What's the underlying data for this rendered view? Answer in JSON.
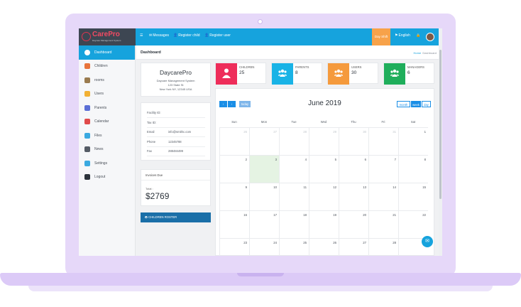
{
  "brand": {
    "name": "CarePro",
    "tagline": "Daycare Management System"
  },
  "topbar": {
    "menu_icon": "hamburger-icon",
    "items": [
      {
        "icon": "envelope-icon",
        "label": "Messages"
      },
      {
        "icon": "user-plus-icon",
        "label": "Register child"
      },
      {
        "icon": "user-plus-icon",
        "label": "Register user"
      }
    ],
    "shift_label": "Day Shift",
    "language": "English",
    "lock_icon": "lock-icon",
    "avatar": "user-avatar"
  },
  "sidebar": {
    "items": [
      {
        "label": "Dashboard",
        "icon": "dashboard-icon",
        "active": true,
        "color": "#2b3540"
      },
      {
        "label": "Children",
        "icon": "children-icon",
        "active": false,
        "color": "#e8743b"
      },
      {
        "label": "rooms",
        "icon": "rooms-icon",
        "active": false,
        "color": "#9a7b4f"
      },
      {
        "label": "Users",
        "icon": "users-icon",
        "active": false,
        "color": "#f2b134"
      },
      {
        "label": "Parents",
        "icon": "parents-icon",
        "active": false,
        "color": "#5b6fd6"
      },
      {
        "label": "Calendar",
        "icon": "calendar-icon",
        "active": false,
        "color": "#e04a4a"
      },
      {
        "label": "Files",
        "icon": "files-icon",
        "active": false,
        "color": "#3aa9e0"
      },
      {
        "label": "News",
        "icon": "news-icon",
        "active": false,
        "color": "#555c66"
      },
      {
        "label": "Settings",
        "icon": "settings-icon",
        "active": false,
        "color": "#3aa9e0"
      },
      {
        "label": "Logout",
        "icon": "power-icon",
        "active": false,
        "color": "#2c333b"
      }
    ]
  },
  "page": {
    "title": "Dashboard",
    "breadcrumb": {
      "home": "Home",
      "current": "Dashboard"
    }
  },
  "facility": {
    "name": "DaycarePro",
    "subtitle": "Daycare Management System",
    "address1": "123 State St",
    "address2": "New York NY, 12345 USA"
  },
  "facility_info": [
    {
      "label": "Facility ID:",
      "value": ""
    },
    {
      "label": "Tax ID:",
      "value": ""
    },
    {
      "label": "Email",
      "value": "info@smithc.com"
    },
    {
      "label": "Phone",
      "value": "12345788"
    },
    {
      "label": "Fax",
      "value": "288484499"
    }
  ],
  "invoices": {
    "title": "Invoices Due",
    "total_label": "Total :",
    "total": "$2769"
  },
  "roster_button": {
    "icon": "print-icon",
    "label": "CHILDREN ROSTER"
  },
  "stats": [
    {
      "label": "CHILDREN",
      "value": "25",
      "color": "#ee2d5a",
      "icon": "child-icon"
    },
    {
      "label": "PARENTS",
      "value": "8",
      "color": "#19b3e6",
      "icon": "group-icon"
    },
    {
      "label": "USERS",
      "value": "30",
      "color": "#f59a3c",
      "icon": "group-icon"
    },
    {
      "label": "MANAGERS",
      "value": "6",
      "color": "#1fae5b",
      "icon": "group-icon"
    }
  ],
  "calendar": {
    "title": "June 2019",
    "prev_icon": "chevron-left-icon",
    "next_icon": "chevron-right-icon",
    "today_label": "today",
    "views": [
      "month",
      "week",
      "day"
    ],
    "active_view": "week",
    "weekdays": [
      "Sun",
      "Mon",
      "Tue",
      "Wed",
      "Thu",
      "Fri",
      "Sat"
    ],
    "weeks": [
      [
        {
          "d": "26",
          "other": true
        },
        {
          "d": "27",
          "other": true
        },
        {
          "d": "28",
          "other": true
        },
        {
          "d": "29",
          "other": true
        },
        {
          "d": "30",
          "other": true
        },
        {
          "d": "31",
          "other": true
        },
        {
          "d": "1",
          "other": false
        }
      ],
      [
        {
          "d": "2",
          "other": false
        },
        {
          "d": "3",
          "other": false,
          "today": true
        },
        {
          "d": "4",
          "other": false
        },
        {
          "d": "5",
          "other": false
        },
        {
          "d": "6",
          "other": false
        },
        {
          "d": "7",
          "other": false
        },
        {
          "d": "8",
          "other": false
        }
      ],
      [
        {
          "d": "9",
          "other": false
        },
        {
          "d": "10",
          "other": false
        },
        {
          "d": "11",
          "other": false
        },
        {
          "d": "12",
          "other": false
        },
        {
          "d": "13",
          "other": false
        },
        {
          "d": "14",
          "other": false
        },
        {
          "d": "15",
          "other": false
        }
      ],
      [
        {
          "d": "16",
          "other": false
        },
        {
          "d": "17",
          "other": false
        },
        {
          "d": "18",
          "other": false
        },
        {
          "d": "19",
          "other": false
        },
        {
          "d": "20",
          "other": false
        },
        {
          "d": "21",
          "other": false
        },
        {
          "d": "22",
          "other": false
        }
      ],
      [
        {
          "d": "23",
          "other": false
        },
        {
          "d": "24",
          "other": false
        },
        {
          "d": "25",
          "other": false
        },
        {
          "d": "26",
          "other": false
        },
        {
          "d": "27",
          "other": false
        },
        {
          "d": "28",
          "other": false
        },
        {
          "d": "29",
          "other": false
        }
      ]
    ]
  },
  "chat_fab_icon": "chat-icon"
}
